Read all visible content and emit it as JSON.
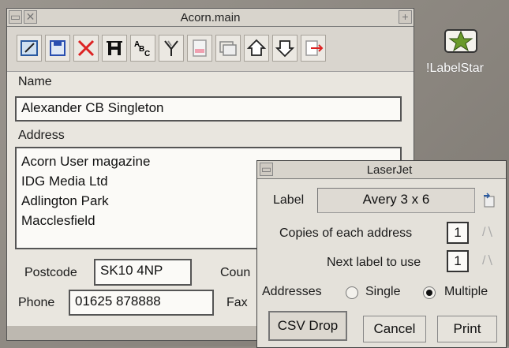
{
  "main_window": {
    "title": "Acorn.main",
    "toolbar_icons": [
      "edit-icon",
      "save-disk-icon",
      "delete-x-icon",
      "h-frame-icon",
      "abc-icon",
      "merge-fork-icon",
      "print-preview-icon",
      "window-stack-icon",
      "upload-house-icon",
      "download-house-icon",
      "export-arrows-icon"
    ],
    "name_label": "Name",
    "name_value": "Alexander CB Singleton",
    "address_label": "Address",
    "address_lines": [
      "Acorn User magazine",
      "IDG Media Ltd",
      "Adlington Park",
      "Macclesfield"
    ],
    "postcode_label": "Postcode",
    "postcode_value": "SK10 4NP",
    "country_label": "Coun",
    "phone_label": "Phone",
    "phone_value": "01625 878888",
    "fax_label": "Fax"
  },
  "desktop_icon": {
    "label": "!LabelStar",
    "icon": "labelstar-star-icon"
  },
  "laser_window": {
    "title": "LaserJet",
    "label_label": "Label",
    "label_value": "Avery 3 x 6",
    "copies_label": "Copies of each address",
    "copies_value": "1",
    "next_label": "Next label to use",
    "next_value": "1",
    "addresses_label": "Addresses",
    "single_label": "Single",
    "multiple_label": "Multiple",
    "selected_option": "Multiple",
    "csv_drop_label": "CSV Drop",
    "cancel_label": "Cancel",
    "print_label": "Print"
  },
  "colors": {
    "window_bg": "#e9e6df",
    "desktop_bg": "#8f8a83",
    "label_star_green": "#6a9a2a"
  }
}
